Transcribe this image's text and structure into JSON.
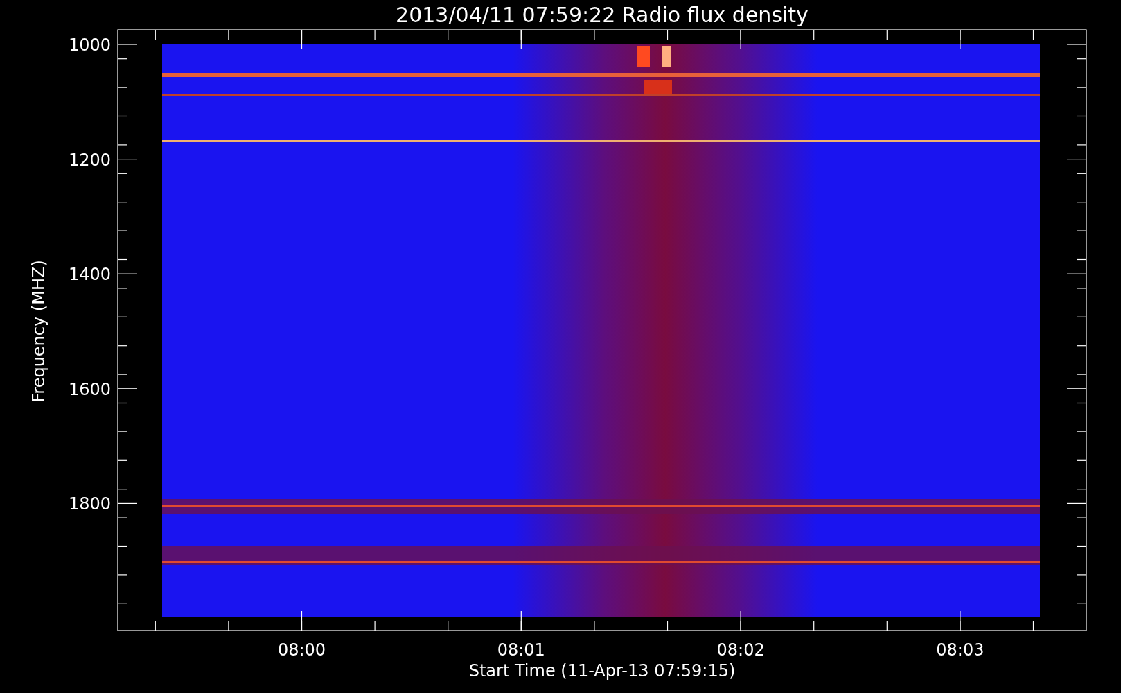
{
  "title": "2013/04/11 07:59:22 Radio flux density",
  "y_axis": {
    "label": "Frequency (MHZ)",
    "ticks": [
      "1000",
      "1200",
      "1400",
      "1600",
      "1800"
    ]
  },
  "x_axis": {
    "label": "Start Time (11-Apr-13 07:59:15)",
    "ticks": [
      "08:00",
      "08:01",
      "08:02",
      "08:03"
    ]
  }
}
